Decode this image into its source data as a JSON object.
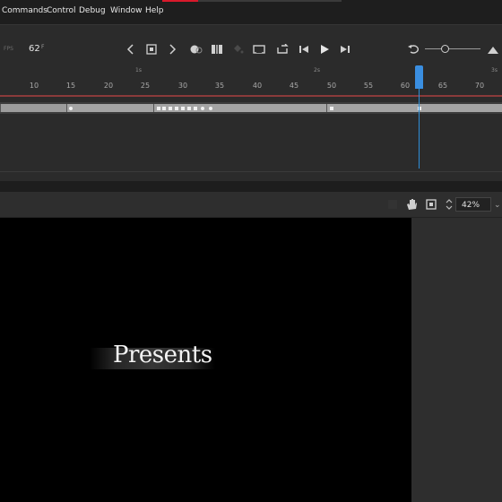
{
  "menu": {
    "items": [
      "Commands",
      "Control",
      "Debug",
      "Window",
      "Help"
    ]
  },
  "timeline": {
    "fps_label": "FPS",
    "current_frame": "62",
    "frame_suffix": "F",
    "seconds_markers": [
      "1s",
      "2s",
      "3s"
    ],
    "ruler_ticks": [
      "10",
      "15",
      "20",
      "25",
      "30",
      "35",
      "40",
      "45",
      "50",
      "55",
      "60",
      "65",
      "70"
    ]
  },
  "icons": {
    "prev_frame": "chevron-left-icon",
    "insert_keyframe": "keyframe-icon",
    "next_frame": "chevron-right-icon",
    "onion_skin": "onion-skin-icon",
    "edit_multiple": "edit-multiple-icon",
    "loop": "loop-icon",
    "step_back": "step-back-icon",
    "play": "play-icon",
    "step_forward": "step-forward-icon",
    "undo": "undo-icon",
    "mountain": "mountain-icon",
    "hand": "hand-icon",
    "clip": "clip-icon"
  },
  "stage_toolbar": {
    "zoom_value": "42%"
  },
  "stage": {
    "text": "Presents"
  },
  "colors": {
    "accent_red": "#d9192b",
    "playhead_blue": "#3a8ee0",
    "stage_bg": "#000000",
    "panel_bg": "#2b2b2b"
  }
}
